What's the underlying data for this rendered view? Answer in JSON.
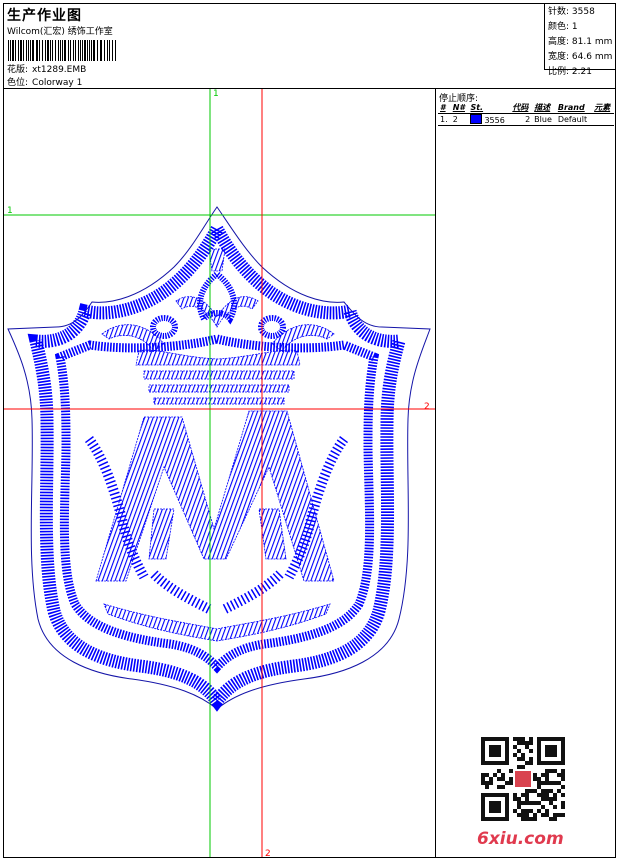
{
  "header": {
    "title": "生产作业图",
    "subtitle": "Wilcom(汇宏) 绣饰工作室",
    "design_label": "花版:",
    "design_value": "xt1289.EMB",
    "colorway_label": "色位:",
    "colorway_value": "Colorway 1"
  },
  "stats": {
    "stitches_label": "针数:",
    "stitches_value": "3558",
    "colors_label": "颜色:",
    "colors_value": "1",
    "height_label": "高度:",
    "height_value": "81.1 mm",
    "width_label": "宽度:",
    "width_value": "64.6 mm",
    "scale_label": "比例:",
    "scale_value": "2.21"
  },
  "design": {
    "guide_v1_label": "1",
    "guide_h1_label": "1",
    "guide_h2_label": "2",
    "guide_v2_label": "2",
    "stitch_color": "#0000ff",
    "outline_color": "#1414a8",
    "guide1_color": "#00c800",
    "guide2_color": "#ff0000"
  },
  "stop_sequence": {
    "title": "停止顺序:",
    "columns": [
      "#",
      "N#",
      "St.",
      "代码",
      "描述",
      "Brand",
      "元素"
    ],
    "rows": [
      {
        "index": "1.",
        "needle": "2",
        "color": "#0000ff",
        "stitches": "3556",
        "code": "2",
        "description": "Blue",
        "brand": "Default",
        "element": ""
      }
    ]
  },
  "watermark": {
    "text": "6xiu.com",
    "color": "#e03a4e"
  }
}
